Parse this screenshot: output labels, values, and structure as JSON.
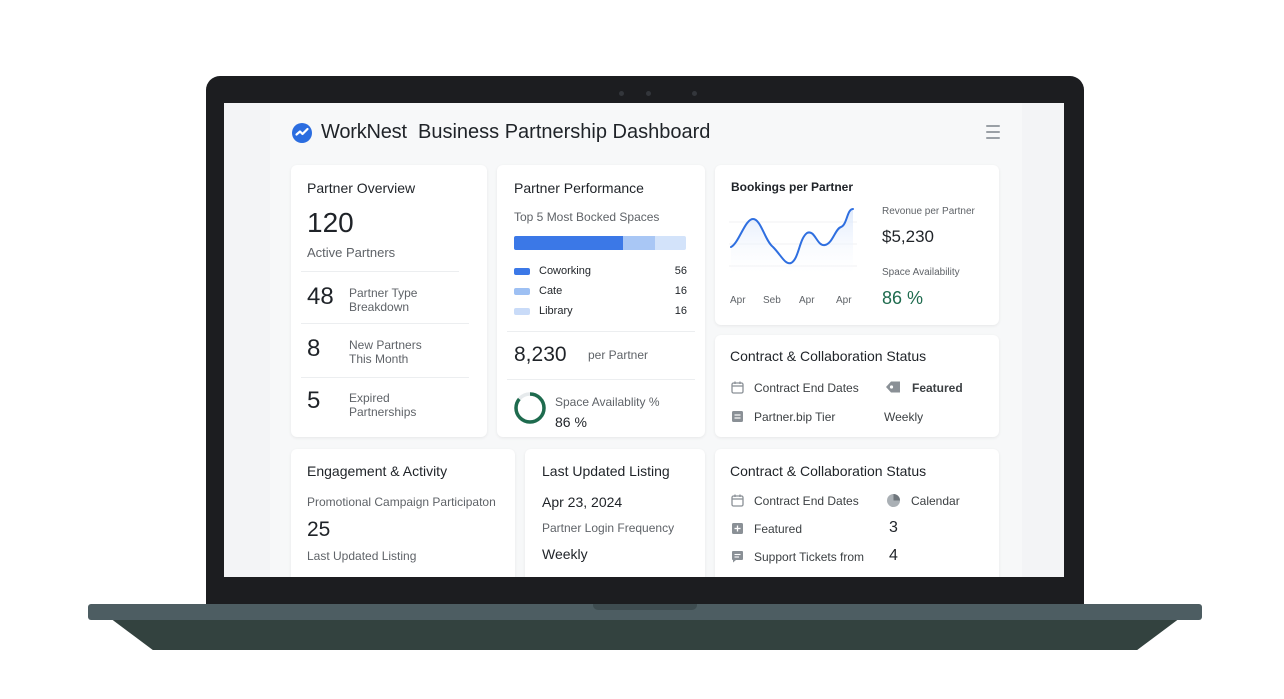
{
  "header": {
    "brand": "WorkNest",
    "title": "Business Partnership Dashboard",
    "logo_icon": "worknest-logo-icon",
    "menu_icon": "hamburger-menu-icon"
  },
  "partner_overview": {
    "title": "Partner Overview",
    "active_count": "120",
    "active_label": "Active Partners",
    "rows": [
      {
        "value": "48",
        "label_line1": "Partner Type",
        "label_line2": "Breakdown"
      },
      {
        "value": "8",
        "label_line1": "New Partners",
        "label_line2": "This Month"
      },
      {
        "value": "5",
        "label_line1": "Expired",
        "label_line2": "Partnerships"
      }
    ]
  },
  "partner_performance": {
    "title": "Partner Performance",
    "subtitle": "Top 5 Most Bocked Spaces",
    "stacked_bar": [
      {
        "label": "Coworking",
        "value": 56,
        "color": "#3b78e7"
      },
      {
        "label": "Cate",
        "value": 16,
        "color": "#a9c7f5"
      },
      {
        "label": "Library",
        "value": 16,
        "color": "#d3e3fa"
      }
    ],
    "legend": [
      {
        "label": "Coworking",
        "value": "56",
        "color": "#3b78e7"
      },
      {
        "label": "Cate",
        "value": "16",
        "color": "#9ec0f3"
      },
      {
        "label": "Library",
        "value": "16",
        "color": "#c9dbf8"
      }
    ],
    "bookings_value": "8,230",
    "bookings_unit": "per Partner",
    "availability_label": "Space Availablity %",
    "availability_value": "86 %",
    "availability_fraction": 0.86,
    "ring_color": "#1e6b4e"
  },
  "bookings_per_partner": {
    "title": "Bookings per Partner",
    "x_labels": [
      "Apr",
      "Seb",
      "Apr",
      "Apr"
    ],
    "line_color": "#2f6fe0",
    "revenue_label": "Revonue per Partner",
    "revenue_value": "$5,230",
    "availability_label": "Space Availability",
    "availability_value": "86 %",
    "availability_color": "#1e6b4e"
  },
  "contract_status_top": {
    "title": "Contract & Collaboration Status",
    "items": [
      {
        "icon": "calendar-icon",
        "label": "Contract End Dates"
      },
      {
        "icon": "list-icon",
        "label": "Partner.bip Tier"
      }
    ],
    "right": [
      {
        "icon": "tag-icon",
        "label": "Featured"
      },
      {
        "label": "Weekly"
      }
    ]
  },
  "engagement": {
    "title": "Engagement & Activity",
    "campaign_label": "Promotional Campaign Participaton",
    "campaign_value": "25",
    "listing_label": "Last Updated Listing"
  },
  "last_updated": {
    "title": "Last Updated Listing",
    "date": "Apr 23, 2024",
    "login_label": "Partner Login Frequency",
    "login_value": "Weekly"
  },
  "contract_status_bottom": {
    "title": "Contract & Collaboration Status",
    "items": [
      {
        "icon": "calendar-icon",
        "label": "Contract End Dates"
      },
      {
        "icon": "plus-box-icon",
        "label": "Featured"
      },
      {
        "icon": "chat-icon",
        "label": "Support Tickets from"
      }
    ],
    "right": [
      {
        "icon": "pie-icon",
        "label": "Calendar"
      },
      {
        "label": "3"
      },
      {
        "label": "4"
      }
    ]
  }
}
